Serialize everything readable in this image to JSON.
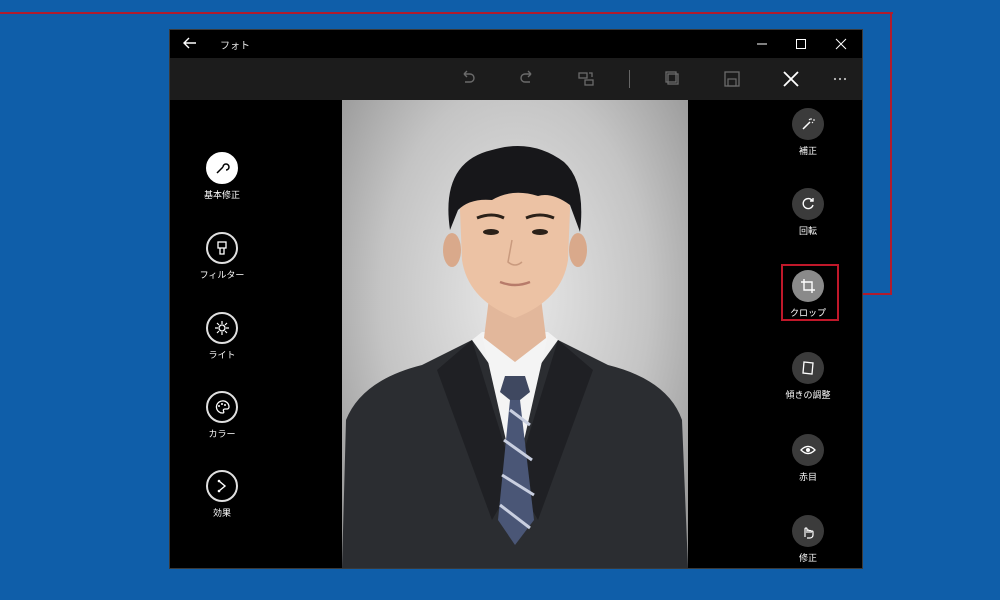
{
  "window": {
    "title": "フォト",
    "controls": [
      "minimize",
      "maximize",
      "close"
    ]
  },
  "toolbar": {
    "items": [
      "undo-icon",
      "redo-icon",
      "compare-icon",
      "save-copy-icon",
      "save-icon",
      "close-icon",
      "more-icon"
    ]
  },
  "left_panel": {
    "items": [
      {
        "label": "基本修正",
        "icon": "wrench-icon",
        "active": true
      },
      {
        "label": "フィルター",
        "icon": "filter-icon",
        "active": false
      },
      {
        "label": "ライト",
        "icon": "sun-icon",
        "active": false
      },
      {
        "label": "カラー",
        "icon": "palette-icon",
        "active": false
      },
      {
        "label": "効果",
        "icon": "effects-icon",
        "active": false
      }
    ]
  },
  "right_panel": {
    "items": [
      {
        "label": "補正",
        "icon": "magic-wand-icon",
        "active": false
      },
      {
        "label": "回転",
        "icon": "rotate-icon",
        "active": false
      },
      {
        "label": "クロップ",
        "icon": "crop-icon",
        "active": true
      },
      {
        "label": "傾きの調整",
        "icon": "straighten-icon",
        "active": false
      },
      {
        "label": "赤目",
        "icon": "eye-icon",
        "active": false
      },
      {
        "label": "修正",
        "icon": "retouch-icon",
        "active": false
      }
    ]
  },
  "colors": {
    "background": "#0f5ea9",
    "callout": "#b01c2e",
    "window": "#000000",
    "toolbar": "#1c1c1c"
  }
}
